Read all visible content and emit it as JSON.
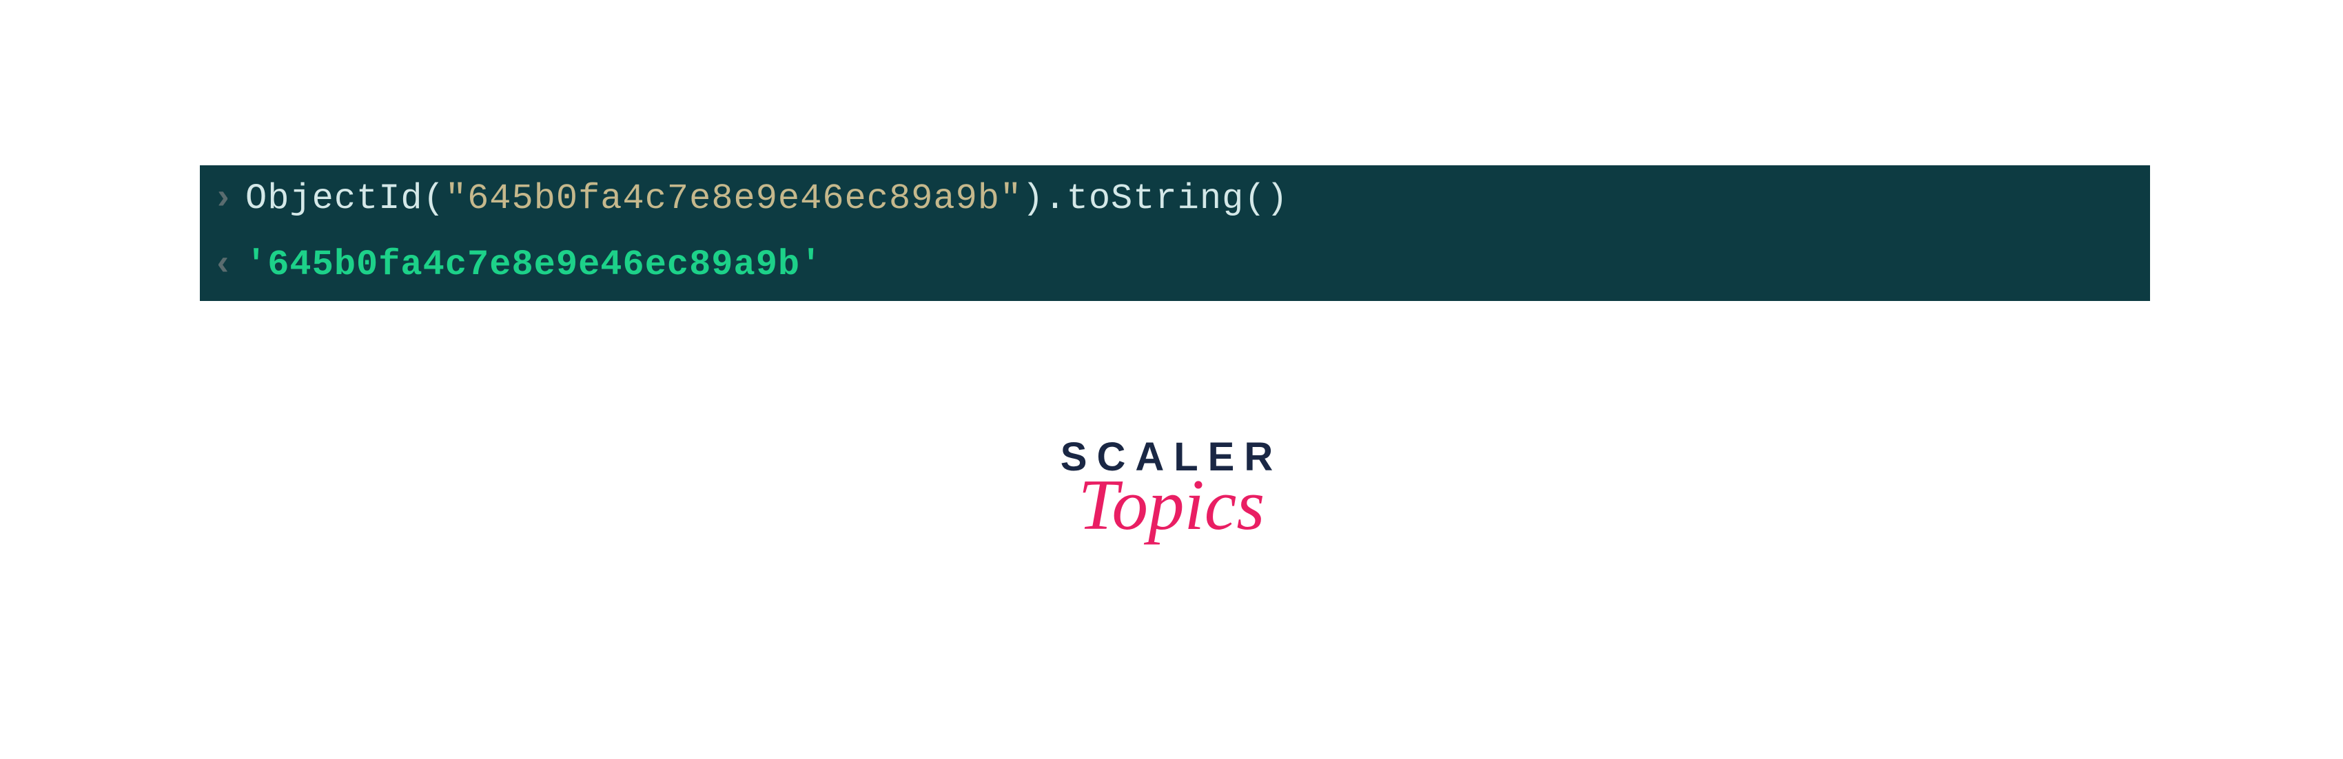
{
  "console": {
    "input": {
      "prompt": "›",
      "method_start": "ObjectId",
      "paren_open": "(",
      "string_value": "\"645b0fa4c7e8e9e46ec89a9b\"",
      "paren_close": ")",
      "chain": ".toString()",
      "full_line": "ObjectId(\"645b0fa4c7e8e9e46ec89a9b\").toString()"
    },
    "output": {
      "prompt": "‹",
      "value": "'645b0fa4c7e8e9e46ec89a9b'"
    }
  },
  "logo": {
    "line1": "SCALER",
    "line2": "Topics"
  }
}
